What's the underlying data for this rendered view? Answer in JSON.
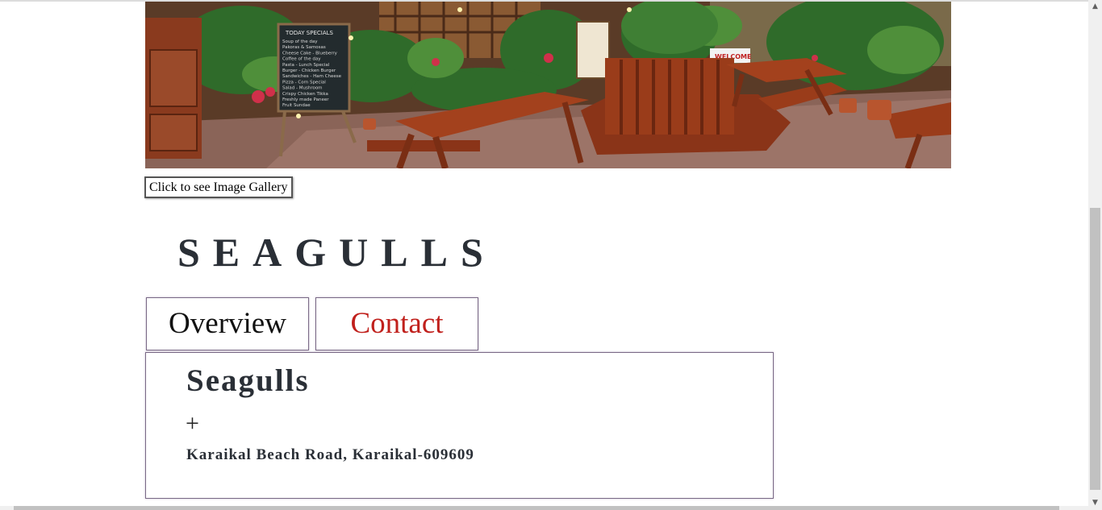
{
  "hero": {
    "chalkboard": {
      "heading": "TODAY SPECIALS",
      "lines": [
        "Soup of the day",
        "Pakoras & Samosas",
        "Cheese Cake - Blueberry",
        "Coffee of the day",
        "Pasta - Lunch Special",
        "Burger - Chicken Burger",
        "Sandwiches - Ham Cheese",
        "Pizza - Corn Special",
        "Salad - Mushroom",
        "Crispy Chicken Tikka",
        "Freshly made Paneer",
        "Fruit Sundae"
      ]
    },
    "sign_text": "WELCOME"
  },
  "gallery_button": {
    "label": "Click to see Image Gallery"
  },
  "brand": {
    "name": "SEAGULLS"
  },
  "tabs": [
    {
      "label": "Overview"
    },
    {
      "label": "Contact"
    }
  ],
  "panel": {
    "title": "Seagulls",
    "expand_symbol": "+",
    "address": "Karaikal Beach Road, Karaikal-609609"
  },
  "colors": {
    "accent_tab": "#c0201c",
    "heading": "#2a2f36",
    "border": "#7a6a86"
  }
}
